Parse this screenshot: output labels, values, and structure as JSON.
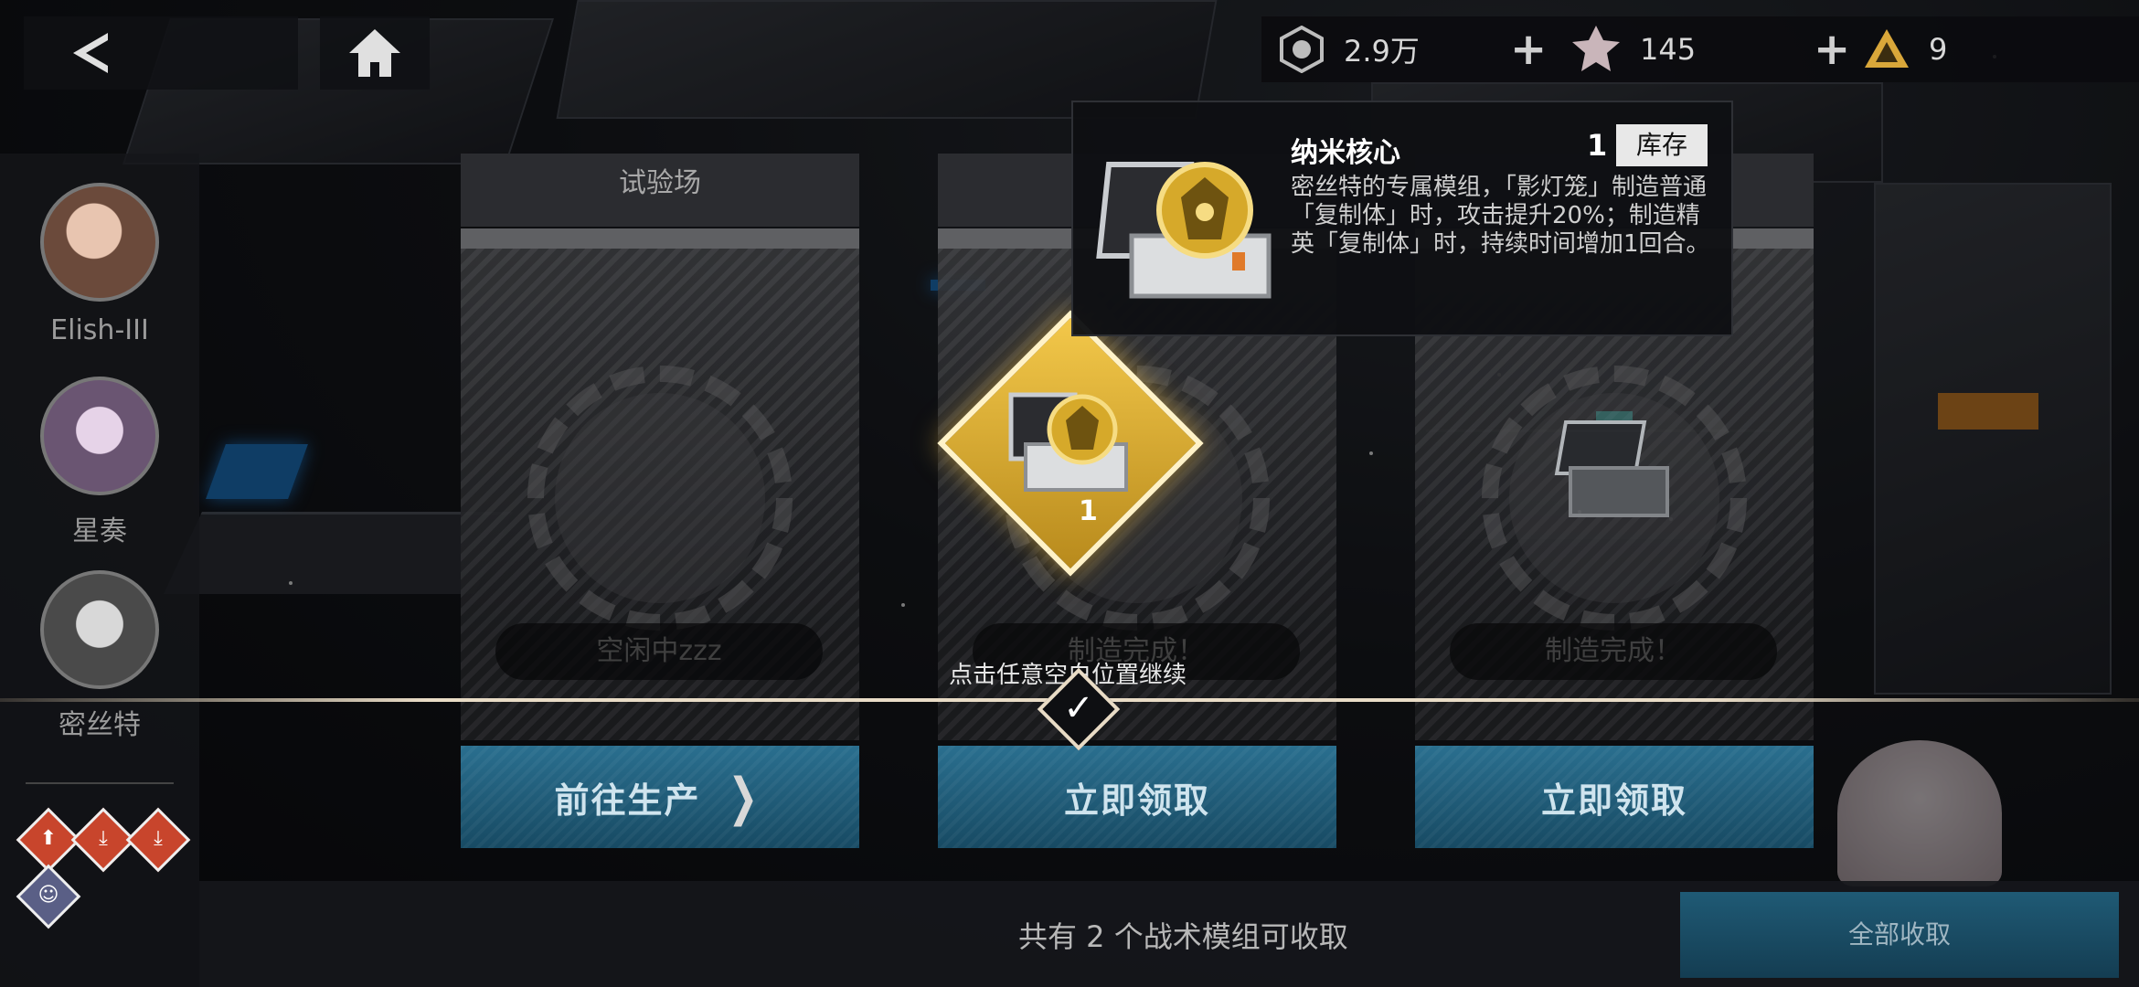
{
  "topbar": {
    "back_icon": "chevron-left-icon",
    "home_icon": "home-icon",
    "resources": [
      {
        "icon": "emblem-icon",
        "value": "2.9万",
        "has_plus": true
      },
      {
        "icon": "gear-shard-icon",
        "value": "145",
        "has_plus": true
      },
      {
        "icon": "triangle-crystal-icon",
        "value": "9",
        "has_plus": false
      }
    ]
  },
  "characters": [
    {
      "name": "Elish-III",
      "color": "#6b4a3b"
    },
    {
      "name": "星奏",
      "color": "#6a5572"
    },
    {
      "name": "密丝特",
      "color": "#4a4a4a"
    }
  ],
  "mini_icons": [
    {
      "icon": "shield-upgrade-icon",
      "color": "#c8452c"
    },
    {
      "icon": "download-icon",
      "color": "#c8452c"
    },
    {
      "icon": "download-icon",
      "color": "#c8452c"
    },
    {
      "icon": "character-face-icon",
      "color": "#5a5f86"
    }
  ],
  "cards": [
    {
      "title": "试验场",
      "status": "空闲中zzz",
      "action": "前往生产",
      "has_chevron": true
    },
    {
      "title": "",
      "status": "制造完成！",
      "action": "立即领取",
      "has_chevron": false
    },
    {
      "title": "",
      "status": "制造完成！",
      "action": "立即领取",
      "has_chevron": false
    }
  ],
  "continue_hint": "点击任意空白位置继续",
  "reward": {
    "count": "1"
  },
  "tooltip": {
    "title": "纳米核心",
    "quantity": "1",
    "stock_label": "库存",
    "description": "密丝特的专属模组，「影灯笼」制造普通「复制体」时，攻击提升20%；制造精英「复制体」时，持续时间增加1回合。"
  },
  "bottom": {
    "summary": "共有  2 个战术模组可收取",
    "collect_all": "全部收取"
  }
}
